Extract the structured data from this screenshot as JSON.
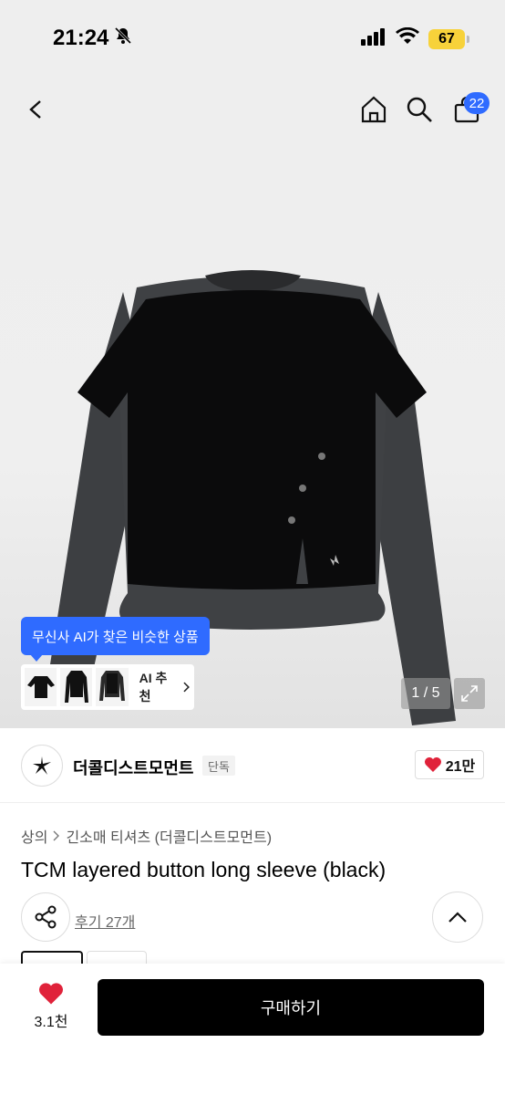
{
  "status_bar": {
    "time": "21:24",
    "battery": "67"
  },
  "header": {
    "cart_count": "22"
  },
  "gallery": {
    "ai_tooltip": "무신사 AI가 찾은 비슷한 상품",
    "ai_recommend_label": "AI 추천",
    "pager": "1 / 5"
  },
  "brand": {
    "name": "더콜디스트모먼트",
    "tag": "단독",
    "likes": "21만"
  },
  "breadcrumb": {
    "category": "상의",
    "subcategory": "긴소매 티셔츠 (더콜디스트모먼트)"
  },
  "product": {
    "title": "TCM layered button long sleeve (black)",
    "reviews": "후기 27개"
  },
  "bottom": {
    "wish_count": "3.1천",
    "buy_label": "구매하기"
  },
  "colors": {
    "accent": "#2f6bff",
    "like": "#e0223a",
    "battery": "#f7d23a"
  }
}
